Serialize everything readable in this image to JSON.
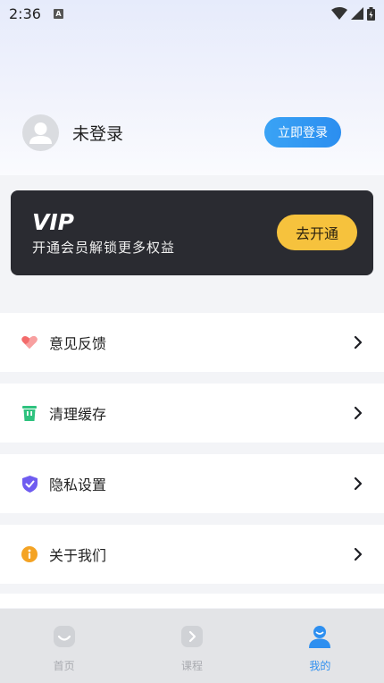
{
  "status_bar": {
    "time": "2:36",
    "a_badge": "A"
  },
  "profile": {
    "username": "未登录",
    "login_button": "立即登录"
  },
  "vip": {
    "logo_text": "VIP",
    "description": "开通会员解锁更多权益",
    "button": "去开通"
  },
  "menu": [
    {
      "label": "意见反馈",
      "icon": "heart-icon",
      "color": "#f36b6b"
    },
    {
      "label": "清理缓存",
      "icon": "trash-icon",
      "color": "#2ec27e"
    },
    {
      "label": "隐私设置",
      "icon": "shield-icon",
      "color": "#6f5cf0"
    },
    {
      "label": "关于我们",
      "icon": "info-icon",
      "color": "#f4a324"
    }
  ],
  "tabs": [
    {
      "label": "首页",
      "icon": "home-icon",
      "active": false
    },
    {
      "label": "课程",
      "icon": "course-icon",
      "active": false
    },
    {
      "label": "我的",
      "icon": "profile-icon",
      "active": true
    }
  ],
  "colors": {
    "accent": "#2e8ff0",
    "vip_bg": "#2a2b31",
    "vip_button": "#f6c23d",
    "inactive_tab": "#a9abb0"
  }
}
